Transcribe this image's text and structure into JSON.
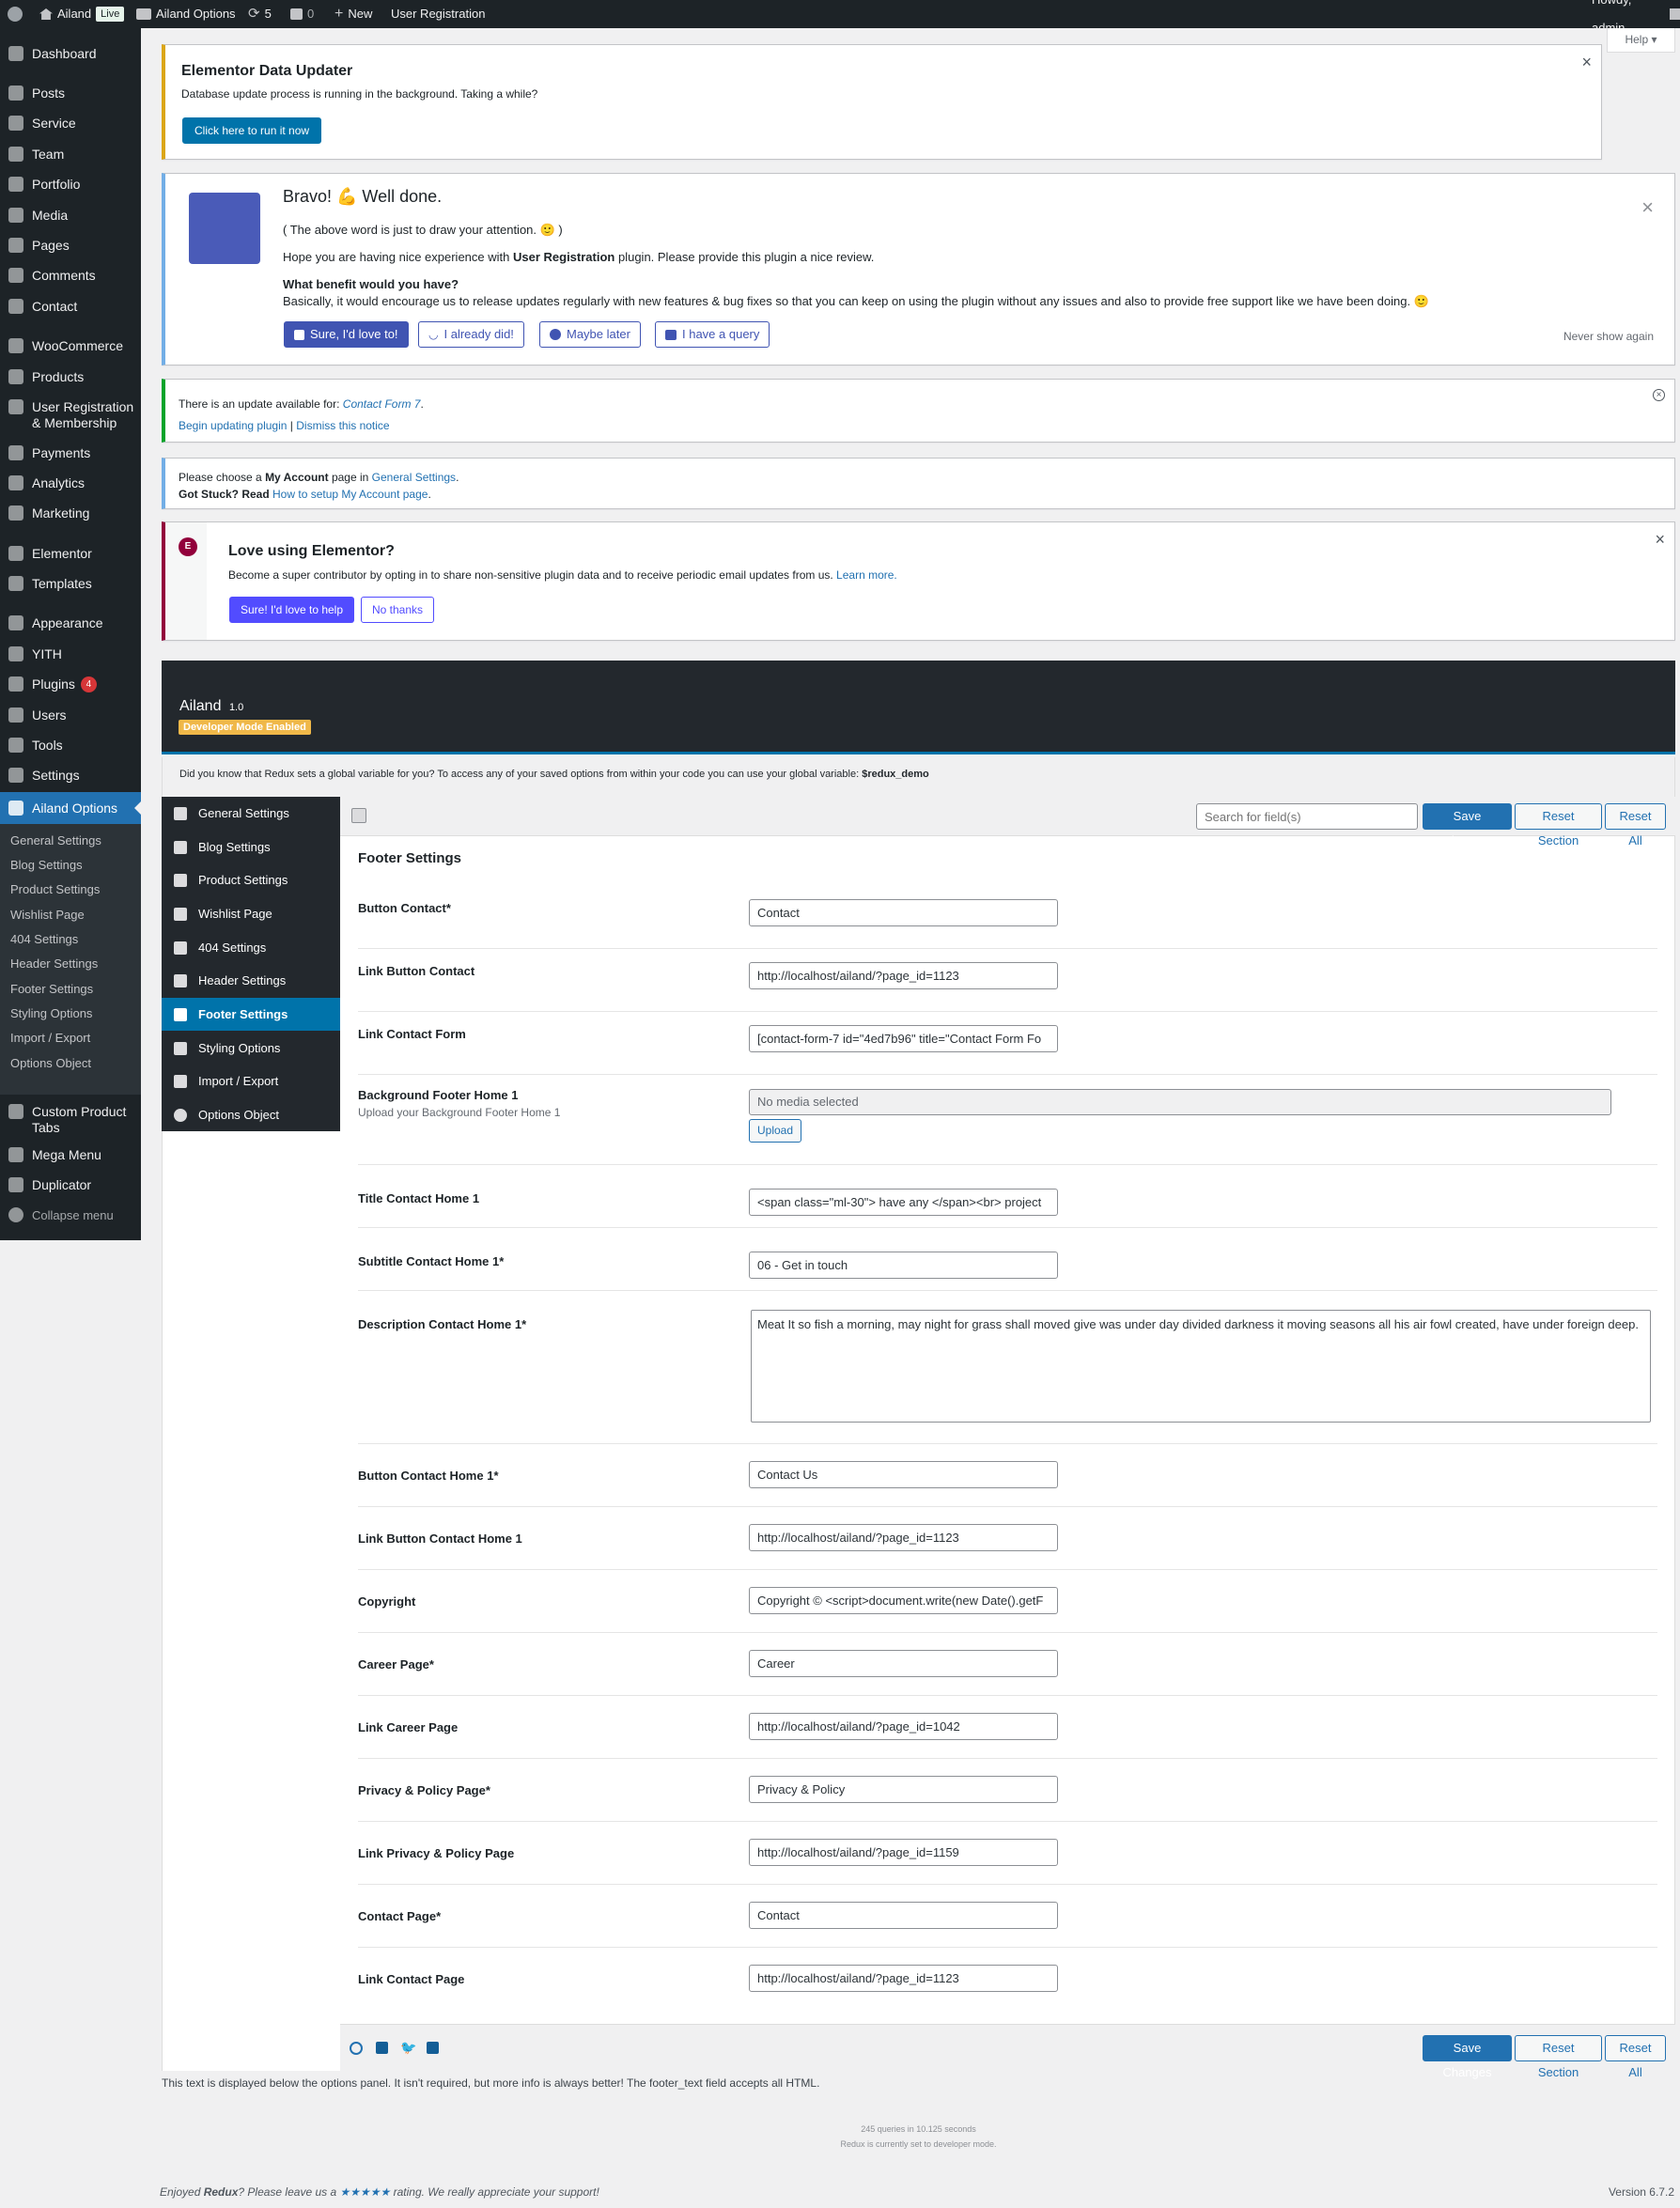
{
  "admin_bar": {
    "site_name": "Ailand",
    "live_badge": "Live",
    "options_link": "Ailand Options",
    "updates_count": "5",
    "comments_count": "0",
    "new_label": "New",
    "user_registration": "User Registration",
    "howdy": "Howdy, admin"
  },
  "help_label": "Help ▾",
  "menu": {
    "items": [
      "Dashboard",
      "Posts",
      "Service",
      "Team",
      "Portfolio",
      "Media",
      "Pages",
      "Comments",
      "Contact",
      "WooCommerce",
      "Products",
      "User Registration",
      "& Membership",
      "Payments",
      "Analytics",
      "Marketing",
      "Elementor",
      "Templates",
      "Appearance",
      "YITH",
      "Plugins",
      "Users",
      "Tools",
      "Settings",
      "Ailand Options",
      "Custom Product",
      "Tabs",
      "Mega Menu",
      "Duplicator",
      "Collapse menu"
    ],
    "plugins_badge": "4",
    "submenu": [
      "General Settings",
      "Blog Settings",
      "Product Settings",
      "Wishlist Page",
      "404 Settings",
      "Header Settings",
      "Footer Settings",
      "Styling Options",
      "Import / Export",
      "Options Object"
    ]
  },
  "notices": {
    "elementor_updater": {
      "title": "Elementor Data Updater",
      "text": "Database update process is running in the background. Taking a while?",
      "button": "Click here to run it now"
    },
    "review": {
      "title": "Bravo! 💪 Well done.",
      "line1": "( The above word is just to draw your attention. 🙂 )",
      "line2_pre": "Hope you are having nice experience with ",
      "line2_bold": "User Registration",
      "line2_post": " plugin. Please provide this plugin a nice review.",
      "question": "What benefit would you have?",
      "answer": "Basically, it would encourage us to release updates regularly with new features & bug fixes so that you can keep on using the plugin without any issues and also to provide free support like we have been doing. 🙂",
      "btn_sure": "Sure, I'd love to!",
      "btn_did": "I already did!",
      "btn_later": "Maybe later",
      "btn_query": "I have a query",
      "never": "Never show again"
    },
    "update": {
      "text_pre": "There is an update available for: ",
      "plugin": "Contact Form 7",
      "text_post": ".",
      "begin": "Begin updating plugin",
      "sep": " | ",
      "dismiss": "Dismiss this notice"
    },
    "account": {
      "line1_pre": "Please choose a ",
      "line1_bold": "My Account",
      "line1_mid": " page in ",
      "line1_link": "General Settings",
      "line1_post": ".",
      "line2_bold": "Got Stuck? Read ",
      "line2_link": "How to setup My Account page",
      "line2_post": "."
    },
    "love_elementor": {
      "title": "Love using Elementor?",
      "text": "Become a super contributor by opting in to share non-sensitive plugin data and to receive periodic email updates from us. ",
      "learn": "Learn more.",
      "btn_yes": "Sure! I'd love to help",
      "btn_no": "No thanks"
    }
  },
  "redux": {
    "title": "Ailand",
    "version": "1.0",
    "dev_badge": "Developer Mode Enabled",
    "info_pre": "Did you know that Redux sets a global variable for you? To access any of your saved options from within your code you can use your global variable: ",
    "info_var": "$redux_demo",
    "nav": [
      "General Settings",
      "Blog Settings",
      "Product Settings",
      "Wishlist Page",
      "404 Settings",
      "Header Settings",
      "Footer Settings",
      "Styling Options",
      "Import / Export",
      "Options Object"
    ],
    "search_placeholder": "Search for field(s)",
    "save": "Save Changes",
    "reset_section": "Reset Section",
    "reset_all": "Reset All",
    "section_title": "Footer Settings",
    "fields": [
      {
        "label": "Button Contact*",
        "value": "Contact"
      },
      {
        "label": "Link Button Contact",
        "value": "http://localhost/ailand/?page_id=1123"
      },
      {
        "label": "Link Contact Form",
        "value": "[contact-form-7 id=\"4ed7b96\" title=\"Contact Form Fo"
      },
      {
        "label": "Background Footer Home 1",
        "desc": "Upload your Background Footer Home 1",
        "value": "No media selected",
        "button": "Upload"
      },
      {
        "label": "Title Contact Home 1",
        "value": "<span class=\"ml-30\"> have any </span><br> project"
      },
      {
        "label": "Subtitle Contact Home 1*",
        "value": "06 - Get in touch"
      },
      {
        "label": "Description Contact Home 1*",
        "value": "Meat It so fish a morning, may night for grass shall moved give was under day divided darkness it moving seasons all his air fowl created, have under foreign deep."
      },
      {
        "label": "Button Contact Home 1*",
        "value": "Contact Us"
      },
      {
        "label": "Link Button Contact Home 1",
        "value": "http://localhost/ailand/?page_id=1123"
      },
      {
        "label": "Copyright",
        "value": "Copyright © <script>document.write(new Date().getF"
      },
      {
        "label": "Career Page*",
        "value": "Career"
      },
      {
        "label": "Link Career Page",
        "value": "http://localhost/ailand/?page_id=1042"
      },
      {
        "label": "Privacy & Policy Page*",
        "value": "Privacy & Policy"
      },
      {
        "label": "Link Privacy & Policy Page",
        "value": "http://localhost/ailand/?page_id=1159"
      },
      {
        "label": "Contact Page*",
        "value": "Contact"
      },
      {
        "label": "Link Contact Page",
        "value": "http://localhost/ailand/?page_id=1123"
      }
    ],
    "footer_text": "This text is displayed below the options panel. It isn't required, but more info is always better! The footer_text field accepts all HTML.",
    "queries": "245 queries in 10.125 seconds",
    "dev_mode": "Redux is currently set to developer mode."
  },
  "wp_footer": {
    "enjoyed_pre": "Enjoyed ",
    "redux": "Redux",
    "enjoyed_mid": "? Please leave us a ",
    "stars": "★★★★★",
    "enjoyed_post": " rating. We really appreciate your support!",
    "version": "Version 6.7.2"
  },
  "colors": {
    "accent": "#2271b1",
    "admin_dark": "#1d2327",
    "elementor": "#92003b",
    "dev_badge": "#f0b849"
  }
}
